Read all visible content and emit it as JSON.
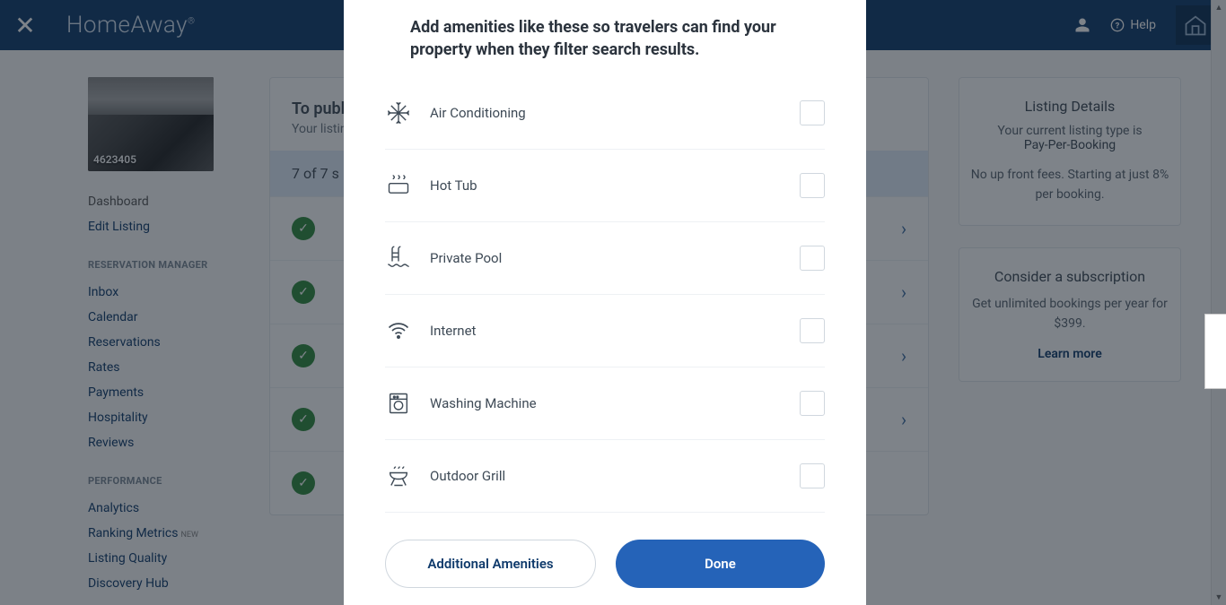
{
  "header": {
    "brand": "HomeAway",
    "help_label": "Help"
  },
  "sidebar": {
    "listing_id": "4623405",
    "items_top": [
      {
        "label": "Dashboard",
        "active": false
      },
      {
        "label": "Edit Listing",
        "active": true
      }
    ],
    "sec_res": "RESERVATION MANAGER",
    "items_res": [
      {
        "label": "Inbox"
      },
      {
        "label": "Calendar"
      },
      {
        "label": "Reservations"
      },
      {
        "label": "Rates"
      },
      {
        "label": "Payments"
      },
      {
        "label": "Hospitality"
      },
      {
        "label": "Reviews"
      }
    ],
    "sec_perf": "PERFORMANCE",
    "items_perf": [
      {
        "label": "Analytics",
        "new": false
      },
      {
        "label": "Ranking Metrics",
        "new": true
      },
      {
        "label": "Listing Quality",
        "new": false
      },
      {
        "label": "Discovery Hub",
        "new": false
      }
    ],
    "new_tag": "NEW"
  },
  "main": {
    "h3": "To publish",
    "p": "Your listing",
    "step": "7 of 7 s"
  },
  "rightcol": {
    "box1_title": "Listing Details",
    "box1_line1": "Your current listing type is",
    "box1_type": "Pay-Per-Booking",
    "box1_fee": "No up front fees. Starting at just 8% per booking.",
    "box2_title": "Consider a subscription",
    "box2_body": "Get unlimited bookings per year for $399.",
    "box2_link": "Learn more"
  },
  "modal": {
    "title": "Add amenities like these so travelers can find your property when they filter search results.",
    "amenities": [
      {
        "label": "Air Conditioning",
        "icon": "snow"
      },
      {
        "label": "Hot Tub",
        "icon": "tub"
      },
      {
        "label": "Private Pool",
        "icon": "pool"
      },
      {
        "label": "Internet",
        "icon": "wifi"
      },
      {
        "label": "Washing Machine",
        "icon": "wash"
      },
      {
        "label": "Outdoor Grill",
        "icon": "grill"
      }
    ],
    "btn_secondary": "Additional Amenities",
    "btn_primary": "Done"
  }
}
